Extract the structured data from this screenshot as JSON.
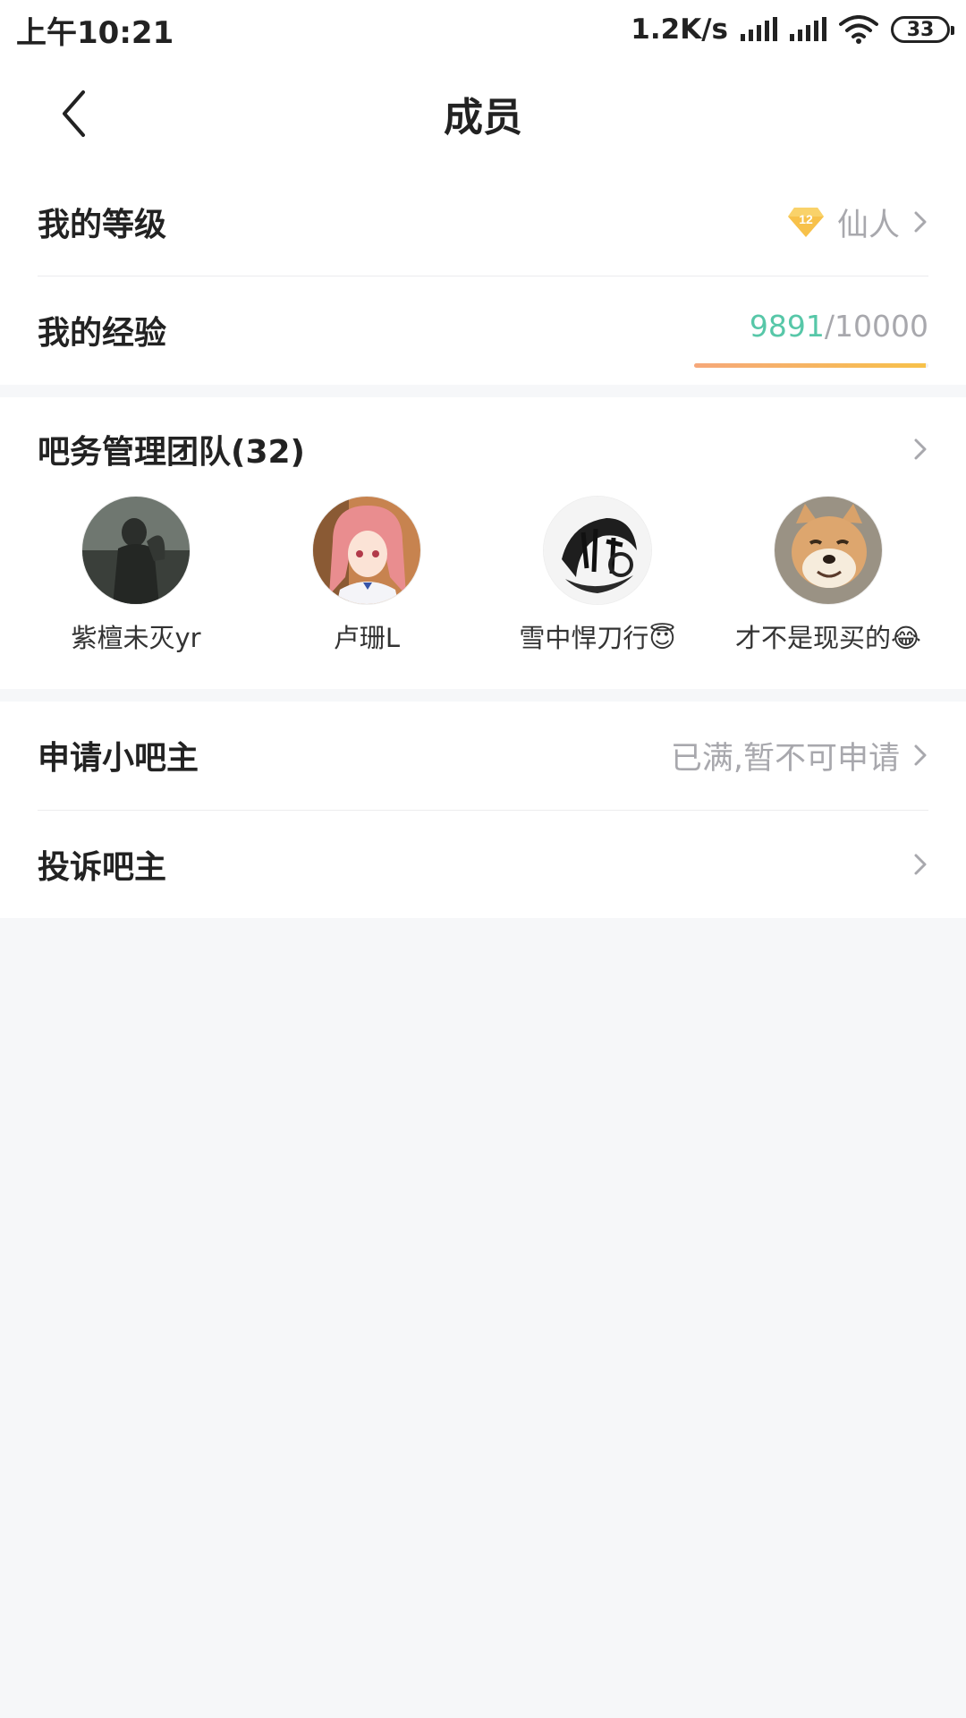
{
  "status_bar": {
    "time": "上午10:21",
    "net_speed": "1.2K/s",
    "battery": "33"
  },
  "nav": {
    "title": "成员"
  },
  "my_level": {
    "label": "我的等级",
    "badge_number": "12",
    "level_name": "仙人"
  },
  "my_exp": {
    "label": "我的经验",
    "current": "9891",
    "separator": "/",
    "total": "10000",
    "progress_fraction": 0.9891
  },
  "team": {
    "label": "吧务管理团队(32)",
    "members": [
      {
        "name": "紫檀未灭yr",
        "avatar": "statue-avatar"
      },
      {
        "name": "卢珊L",
        "avatar": "anime-girl-avatar"
      },
      {
        "name": "雪中悍刀行😇",
        "avatar": "calligraphy-avatar"
      },
      {
        "name": "才不是现买的😂",
        "avatar": "shiba-dog-avatar"
      }
    ]
  },
  "apply": {
    "label": "申请小吧主",
    "status": "已满,暂不可申请"
  },
  "complain": {
    "label": "投诉吧主"
  },
  "colors": {
    "accent_green": "#57c7a8",
    "progress_orange": "#f6a87a",
    "badge_gold": "#f7c14a",
    "muted_gray": "#a8a8ad",
    "background": "#f6f7f9"
  }
}
